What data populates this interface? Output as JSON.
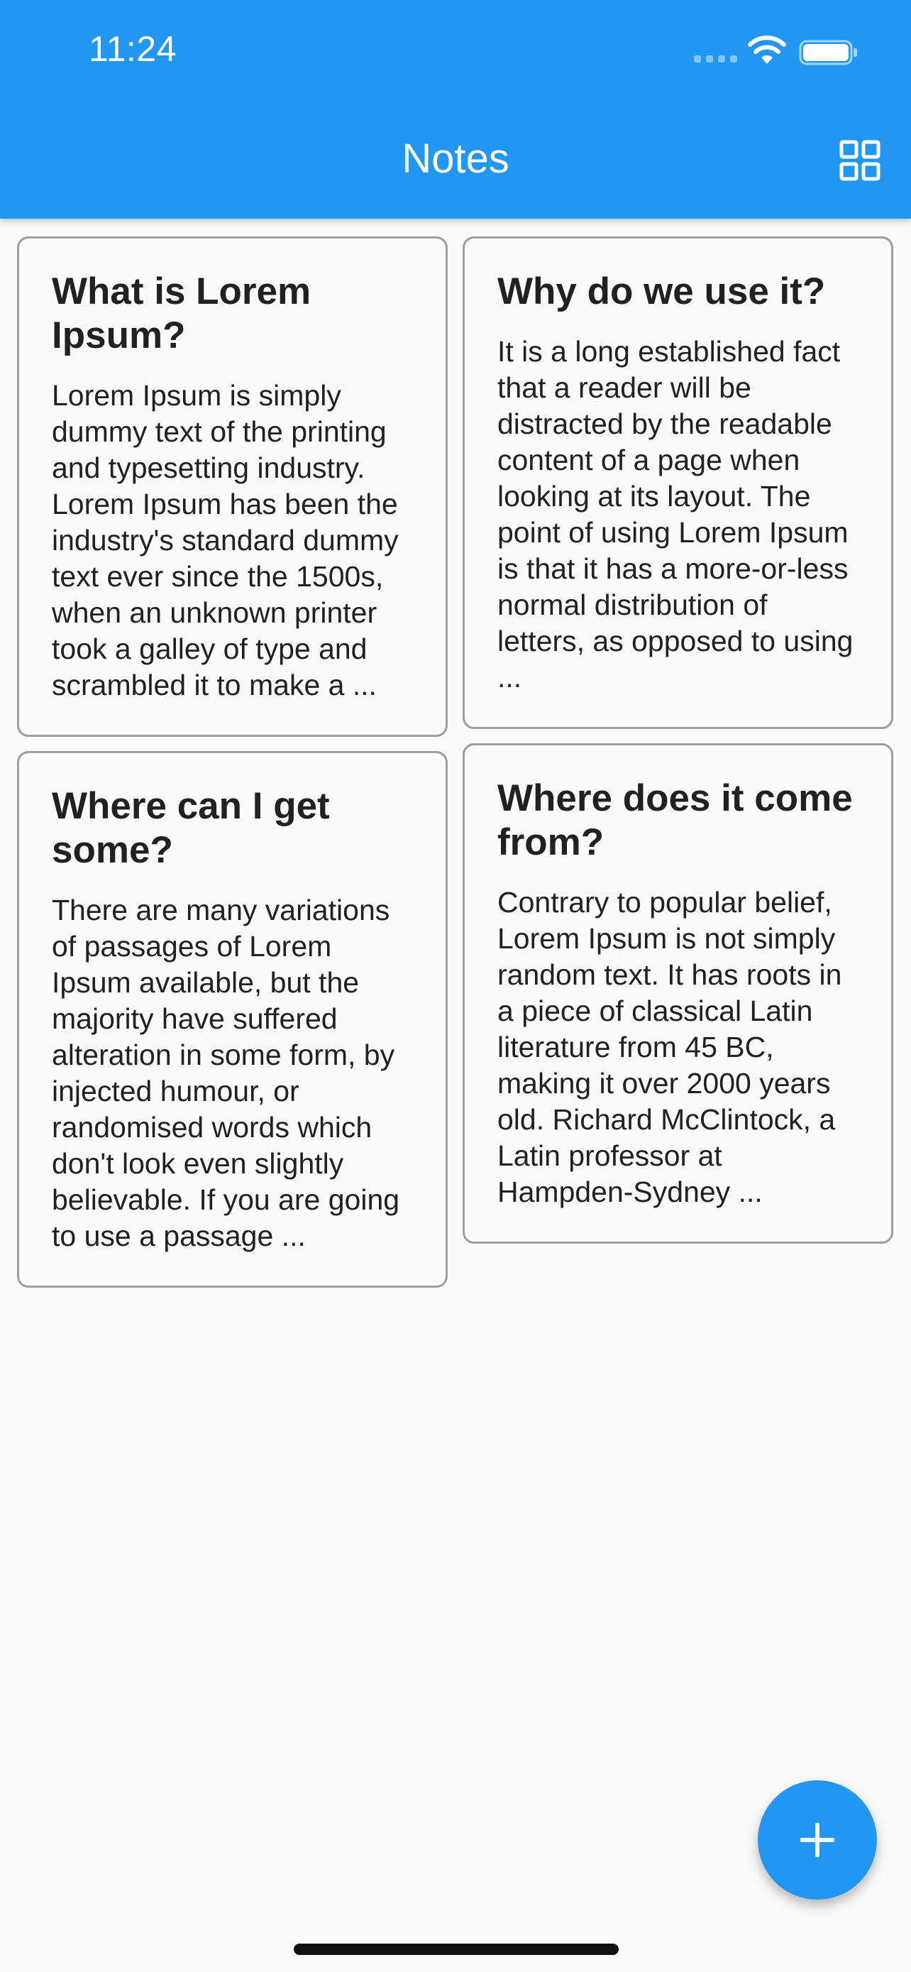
{
  "status_bar": {
    "time": "11:24"
  },
  "header": {
    "title": "Notes",
    "background_color": "#2196f3",
    "view_toggle_icon": "grid-view-icon"
  },
  "notes": [
    {
      "title": "What is Lorem Ipsum?",
      "body": "Lorem Ipsum is simply dummy text of the printing and typesetting industry. Lorem Ipsum has been the industry's standard dummy text ever since the 1500s, when an unknown printer took a galley of type and scrambled it to make a ..."
    },
    {
      "title": "Why do we use it?",
      "body": "It is a long established fact that a reader will be distracted by the readable content of a page when looking at its layout. The point of using Lorem Ipsum is that it has a more-or-less normal distribution of letters, as opposed to using ..."
    },
    {
      "title": "Where can I get some?",
      "body": "There are many variations of passages of Lorem Ipsum available, but the majority have suffered alteration in some form, by injected humour, or randomised words which don't look even slightly believable. If you are going to use a passage ..."
    },
    {
      "title": "Where does it come from?",
      "body": "Contrary to popular belief, Lorem Ipsum is not simply random text. It has roots in a piece of classical Latin literature from 45 BC, making it over 2000 years old. Richard McClintock, a Latin professor at Hampden-Sydney ..."
    }
  ],
  "fab": {
    "icon": "plus-icon",
    "color": "#2196f3"
  }
}
